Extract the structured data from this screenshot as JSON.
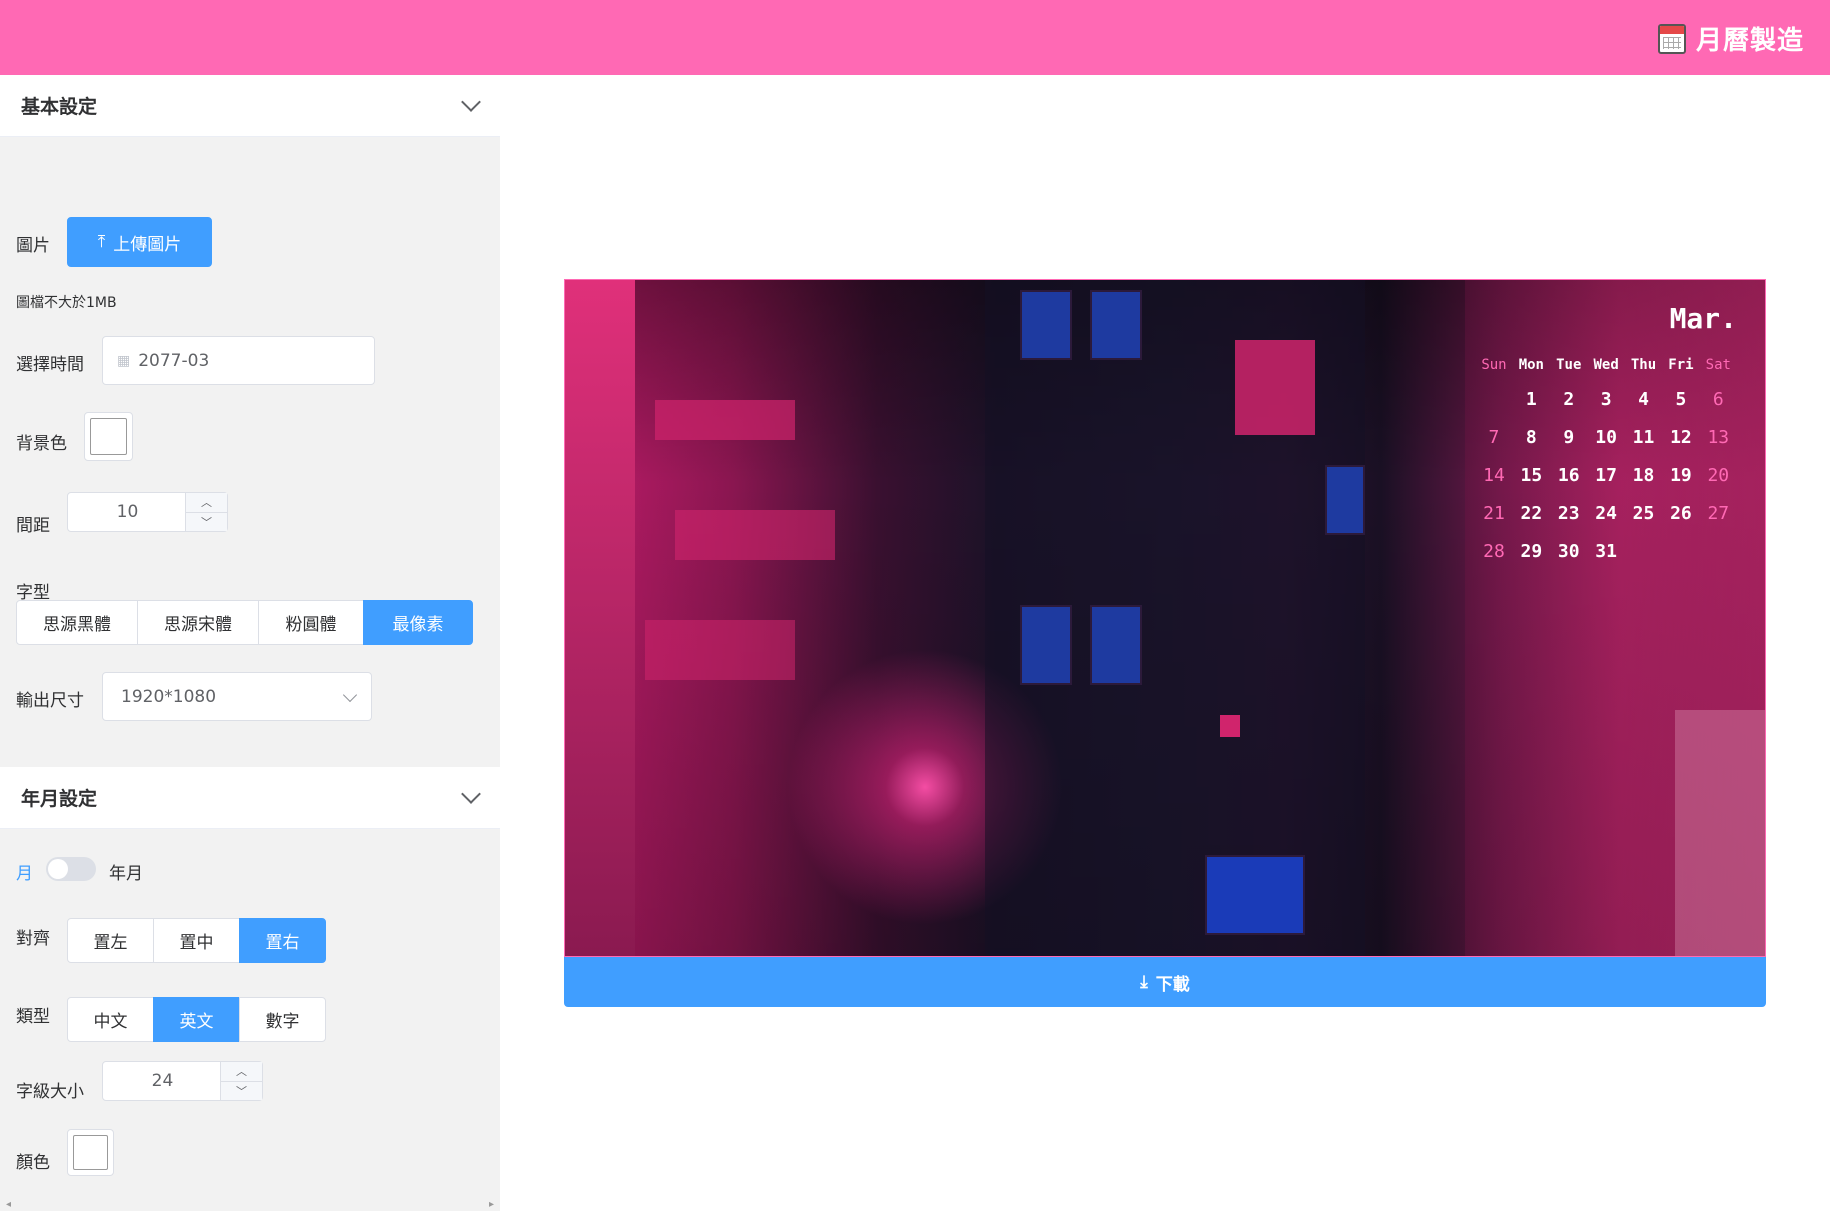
{
  "header": {
    "brand_title": "月曆製造",
    "brand_icon": "calendar-icon",
    "color": "#ff69b4"
  },
  "basic_settings": {
    "title": "基本設定",
    "image_label": "圖片",
    "upload_button": "上傳圖片",
    "upload_hint": "圖檔不大於1MB",
    "time_label": "選擇時間",
    "time_value": "2077-03",
    "bg_color_label": "背景色",
    "spacing_label": "間距",
    "spacing_value": "10",
    "font_label": "字型",
    "font_options": [
      "思源黑體",
      "思源宋體",
      "粉圓體",
      "最像素"
    ],
    "font_selected": "最像素",
    "output_size_label": "輸出尺寸",
    "output_size_value": "1920*1080"
  },
  "month_settings": {
    "title": "年月設定",
    "toggle_left": "月",
    "toggle_right": "年月",
    "align_label": "對齊",
    "align_options": [
      "置左",
      "置中",
      "置右"
    ],
    "align_selected": "置右",
    "type_label": "類型",
    "type_options": [
      "中文",
      "英文",
      "數字"
    ],
    "type_selected": "英文",
    "font_size_label": "字級大小",
    "font_size_value": "24",
    "color_label": "顏色"
  },
  "calendar": {
    "month": "Mar.",
    "weekdays": [
      "Sun",
      "Mon",
      "Tue",
      "Wed",
      "Thu",
      "Fri",
      "Sat"
    ],
    "weeks": [
      [
        "",
        "1",
        "2",
        "3",
        "4",
        "5",
        "6"
      ],
      [
        "7",
        "8",
        "9",
        "10",
        "11",
        "12",
        "13"
      ],
      [
        "14",
        "15",
        "16",
        "17",
        "18",
        "19",
        "20"
      ],
      [
        "21",
        "22",
        "23",
        "24",
        "25",
        "26",
        "27"
      ],
      [
        "28",
        "29",
        "30",
        "31",
        "",
        "",
        ""
      ]
    ],
    "weekend_color": "#ff69b4"
  },
  "download_button": "下載",
  "accent_color": "#409eff"
}
